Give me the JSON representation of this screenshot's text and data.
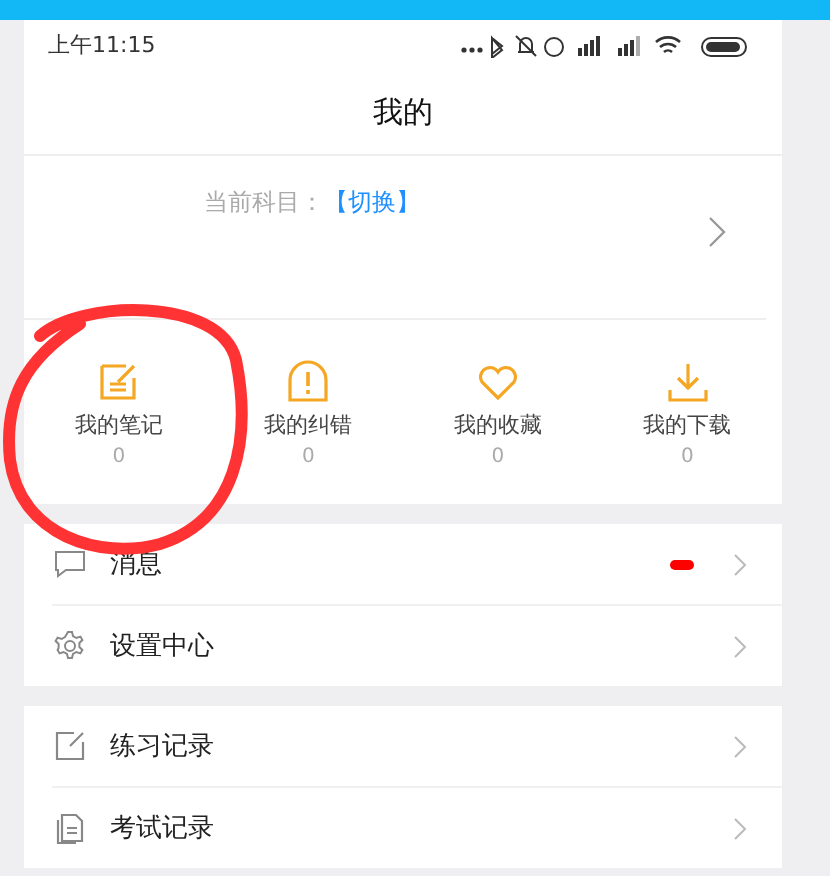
{
  "status_bar": {
    "time": "上午11:15"
  },
  "title": "我的",
  "profile": {
    "subject_label": "当前科目：",
    "switch_link": "【切换】"
  },
  "shortcuts": [
    {
      "kind": "note",
      "label": "我的笔记",
      "count": "0"
    },
    {
      "kind": "error",
      "label": "我的纠错",
      "count": "0"
    },
    {
      "kind": "favorite",
      "label": "我的收藏",
      "count": "0"
    },
    {
      "kind": "download",
      "label": "我的下载",
      "count": "0"
    }
  ],
  "menu_groups": [
    [
      {
        "kind": "message",
        "label": "消息",
        "unread": true
      },
      {
        "kind": "settings",
        "label": "设置中心",
        "unread": false
      }
    ],
    [
      {
        "kind": "practice",
        "label": "练习记录",
        "unread": false
      },
      {
        "kind": "exam",
        "label": "考试记录",
        "unread": false
      }
    ]
  ],
  "annotation": {
    "kind": "circle",
    "color": "#ff3333"
  }
}
